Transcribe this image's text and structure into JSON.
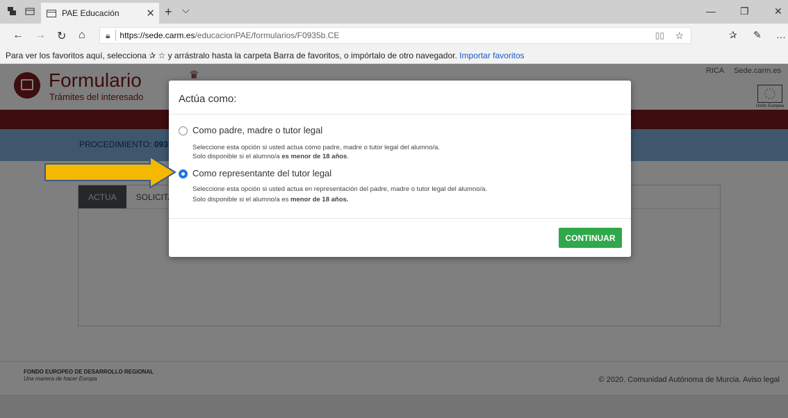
{
  "browser": {
    "tab_title": "PAE Educación",
    "url_host": "https://sede.carm.es",
    "url_path": "/educacionPAE/formularios/F0935b.CE",
    "favorites_bar_text": "Para ver los favoritos aquí, selecciona ✰ ☆ y arrástralo hasta la carpeta Barra de favoritos, o impórtalo de otro navegador.",
    "favorites_bar_link": "Importar favoritos"
  },
  "site": {
    "brand_title": "Formulario",
    "brand_subtitle": "Trámites del interesado",
    "top_links": [
      "RICA",
      "Sede.carm.es"
    ],
    "eu_label": "Unión Europea",
    "procedure_label": "PROCEDIMIENTO:",
    "procedure_code": "0935",
    "panel_tabs": [
      "ACTUA",
      "SOLICITA"
    ],
    "footer_fund": "FONDO EUROPEO DE DESARROLLO REGIONAL",
    "footer_fund_sub": "Una manera de hacer Europa",
    "footer_copyright": "© 2020. Comunidad Autónoma de Murcia. Aviso legal"
  },
  "modal": {
    "title": "Actúa como:",
    "options": [
      {
        "label": "Como padre, madre o tutor legal",
        "desc1": "Seleccione esta opción si usted actua como padre, madre o tutor legal del alumno/a.",
        "desc2_prefix": "Solo disponible si el alumno/a",
        "desc2_bold": "es menor de 18 años",
        "desc2_suffix": ".",
        "checked": false
      },
      {
        "label": "Como representante del tutor legal",
        "desc1": "Seleccione esta opción si usted actua en representación del padre, madre o tutor legal del alumno/a.",
        "desc2_prefix": "Solo disponible si el alumno/a es",
        "desc2_bold": "menor de 18 años.",
        "desc2_suffix": "",
        "checked": true
      }
    ],
    "continue_label": "CONTINUAR"
  },
  "colors": {
    "brand": "#7a1a1f",
    "procedure_bar": "#7faed8",
    "continue_button": "#2ea84a",
    "radio_checked": "#1a73e8",
    "arrow_fill": "#f5b800",
    "arrow_stroke": "#3a5a8c"
  },
  "icons": [
    "tab-actions-icon",
    "tab-preview-icon",
    "page-icon",
    "close-icon",
    "new-tab-icon",
    "chevron-down-icon",
    "back-icon",
    "forward-icon",
    "refresh-icon",
    "home-icon",
    "lock-icon",
    "reading-view-icon",
    "favorite-star-icon",
    "favorites-icon",
    "pen-icon",
    "more-icon",
    "minimize-icon",
    "restore-icon",
    "window-close-icon"
  ]
}
